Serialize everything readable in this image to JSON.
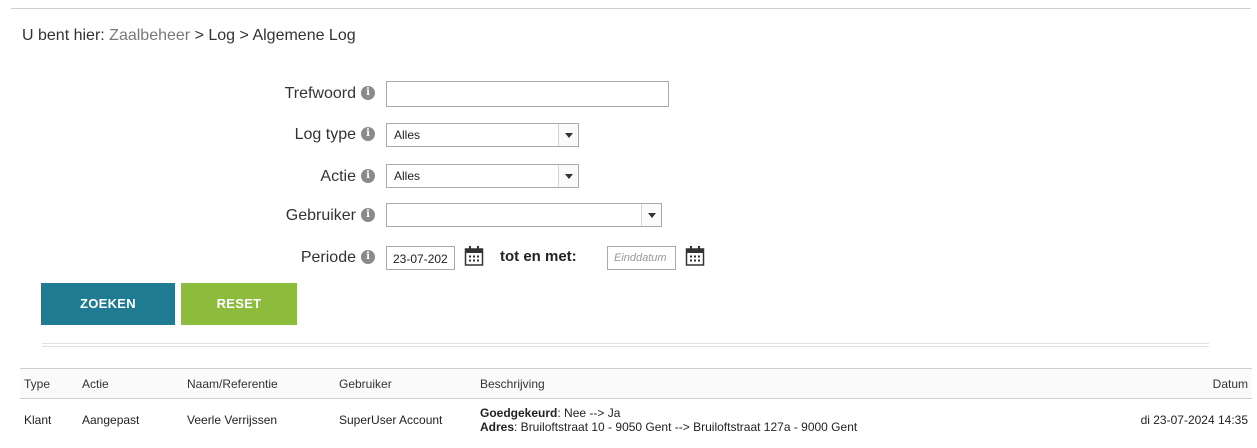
{
  "breadcrumb": {
    "prefix": "U bent hier:",
    "items": [
      "Zaalbeheer",
      ">",
      "Log",
      ">",
      "Algemene Log"
    ]
  },
  "form": {
    "keyword": {
      "label": "Trefwoord",
      "value": ""
    },
    "log_type": {
      "label": "Log type",
      "value": "Alles"
    },
    "action": {
      "label": "Actie",
      "value": "Alles"
    },
    "user": {
      "label": "Gebruiker",
      "value": ""
    },
    "period": {
      "label": "Periode",
      "start_value": "23-07-202",
      "to_label": "tot en met:",
      "end_placeholder": "Einddatum"
    }
  },
  "buttons": {
    "search": "ZOEKEN",
    "reset": "RESET"
  },
  "table": {
    "columns": [
      "Type",
      "Actie",
      "Naam/Referentie",
      "Gebruiker",
      "Beschrijving",
      "Datum"
    ],
    "rows": [
      {
        "type": "Klant",
        "action": "Aangepast",
        "reference": "Veerle Verrijssen",
        "user": "SuperUser Account",
        "description": [
          {
            "key": "Goedgekeurd",
            "value": ": Nee --> Ja"
          },
          {
            "key": "Adres",
            "value": ": Bruiloftstraat 10 - 9050 Gent --> Bruiloftstraat 127a - 9000 Gent"
          }
        ],
        "date": "di 23-07-2024 14:35"
      }
    ]
  },
  "colors": {
    "search_button": "#1e7b92",
    "reset_button": "#8dbb3c"
  },
  "icons": {
    "info": "info-circle-icon",
    "calendar": "calendar-icon",
    "dropdown": "chevron-down-icon"
  }
}
